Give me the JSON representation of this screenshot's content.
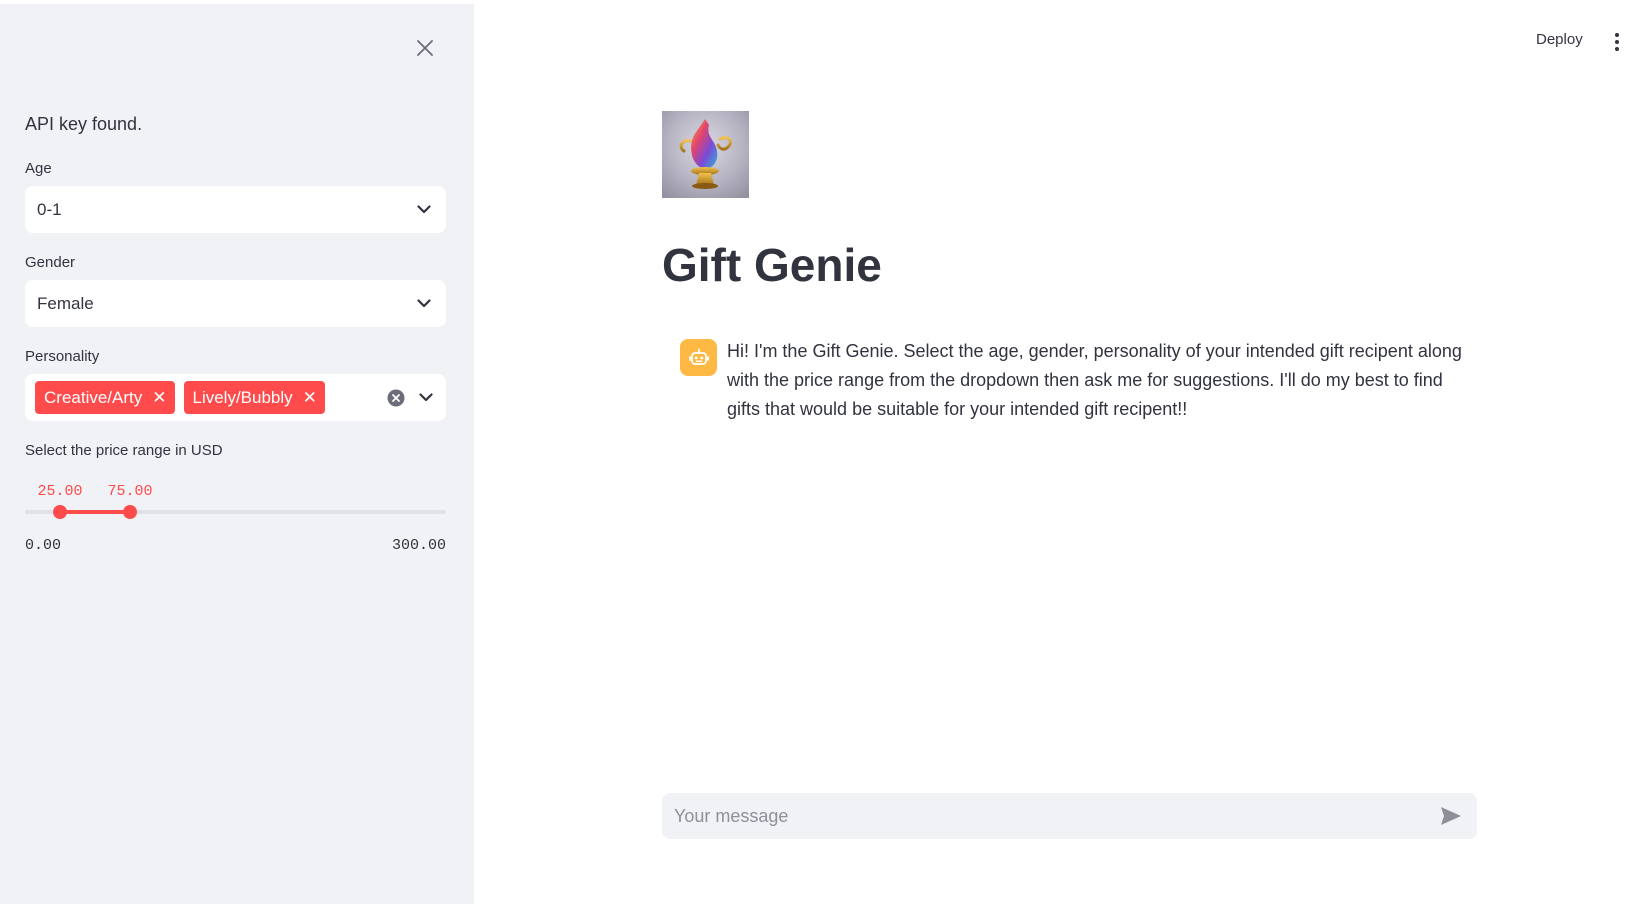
{
  "sidebar": {
    "status": "API key found.",
    "age": {
      "label": "Age",
      "value": "0-1"
    },
    "gender": {
      "label": "Gender",
      "value": "Female"
    },
    "personality": {
      "label": "Personality",
      "chips": [
        "Creative/Arty",
        "Lively/Bubbly"
      ]
    },
    "price": {
      "label": "Select the price range in USD",
      "low": "25.00",
      "high": "75.00",
      "min": "0.00",
      "max": "300.00"
    }
  },
  "header": {
    "deploy_label": "Deploy"
  },
  "main": {
    "title": "Gift Genie",
    "message": "Hi! I'm the Gift Genie. Select the age, gender, personality of your intended gift recipent along with the price range from the dropdown then ask me for suggestions. I'll do my best to find gifts that would be suitable for your intended gift recipent!!"
  },
  "chat_input": {
    "placeholder": "Your message"
  },
  "colors": {
    "accent": "#ff4b4b",
    "sidebar_bg": "#f0f2f6",
    "bot_avatar": "#fdb943",
    "text": "#31333f"
  }
}
